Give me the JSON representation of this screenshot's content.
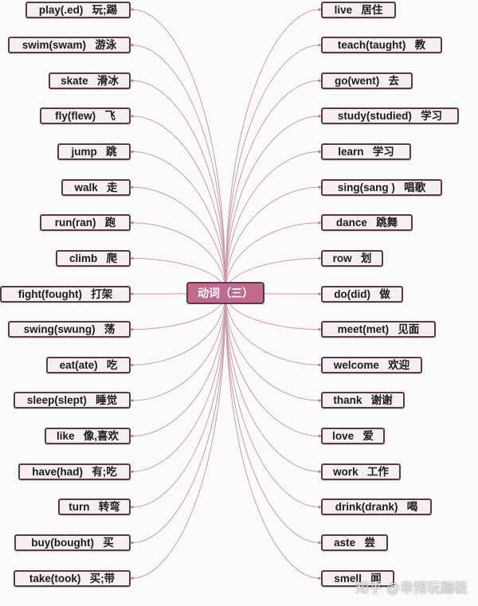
{
  "title": "动词（三）",
  "colors": {
    "center_fill": "#bf6a8e",
    "node_fill": "#f5eef2",
    "node_border": "#5a3a4a",
    "link": "#c79aae"
  },
  "left_nodes": [
    {
      "en": "play(.ed)",
      "zh": "玩;踢"
    },
    {
      "en": "swim(swam)",
      "zh": "游泳"
    },
    {
      "en": "skate",
      "zh": "滑冰"
    },
    {
      "en": "fly(flew)",
      "zh": "飞"
    },
    {
      "en": "jump",
      "zh": "跳"
    },
    {
      "en": "walk",
      "zh": "走"
    },
    {
      "en": "run(ran)",
      "zh": "跑"
    },
    {
      "en": "climb",
      "zh": "爬"
    },
    {
      "en": "fight(fought)",
      "zh": "打架"
    },
    {
      "en": "swing(swung)",
      "zh": "荡"
    },
    {
      "en": "eat(ate)",
      "zh": "吃"
    },
    {
      "en": "sleep(slept)",
      "zh": "睡觉"
    },
    {
      "en": "like",
      "zh": "像,喜欢"
    },
    {
      "en": "have(had)",
      "zh": "有;吃"
    },
    {
      "en": "turn",
      "zh": "转弯"
    },
    {
      "en": "buy(bought)",
      "zh": "买"
    },
    {
      "en": "take(took)",
      "zh": "买;带"
    }
  ],
  "right_nodes": [
    {
      "en": "live",
      "zh": "居住"
    },
    {
      "en": "teach(taught)",
      "zh": "教"
    },
    {
      "en": "go(went)",
      "zh": "去"
    },
    {
      "en": "study(studied)",
      "zh": "学习"
    },
    {
      "en": "learn",
      "zh": "学习"
    },
    {
      "en": "sing(sang )",
      "zh": "唱歌"
    },
    {
      "en": "dance",
      "zh": "跳舞"
    },
    {
      "en": "row",
      "zh": "划"
    },
    {
      "en": "do(did)",
      "zh": "做"
    },
    {
      "en": "meet(met)",
      "zh": "见面"
    },
    {
      "en": "welcome",
      "zh": "欢迎"
    },
    {
      "en": "thank",
      "zh": "谢谢"
    },
    {
      "en": "love",
      "zh": "爱"
    },
    {
      "en": "work",
      "zh": "工作"
    },
    {
      "en": "drink(drank)",
      "zh": "喝"
    },
    {
      "en": "aste",
      "zh": "尝"
    },
    {
      "en": "smell",
      "zh": "闻"
    }
  ],
  "watermark": "知乎 @幸猪玩蹦极"
}
